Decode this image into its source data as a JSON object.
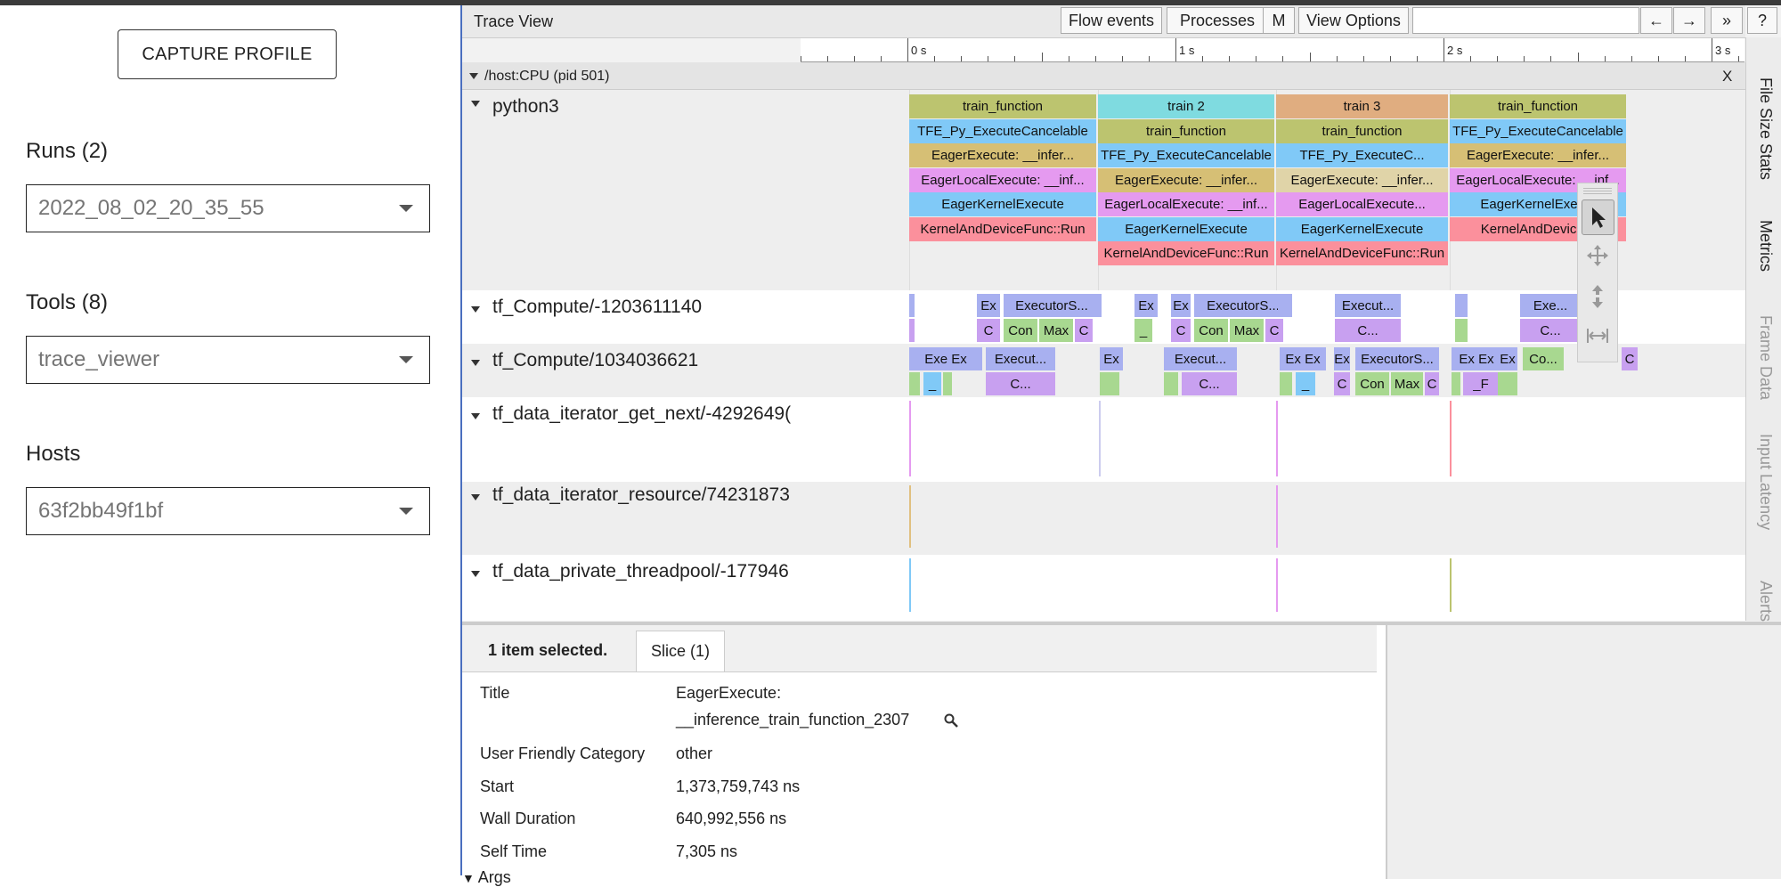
{
  "sidebar": {
    "capture_button": "CAPTURE PROFILE",
    "runs_label": "Runs (2)",
    "runs_value": "2022_08_02_20_35_55",
    "tools_label": "Tools (8)",
    "tools_value": "trace_viewer",
    "hosts_label": "Hosts",
    "hosts_value": "63f2bb49f1bf"
  },
  "trace_view": {
    "title": "Trace View",
    "toolbar": {
      "flow_events": "Flow events",
      "processes": "Processes",
      "m": "M",
      "view_options": "View Options",
      "prev": "←",
      "next": "→",
      "more": "»",
      "help": "?"
    },
    "ruler_labels": [
      "0 s",
      "1 s",
      "2 s",
      "3 s"
    ],
    "process": {
      "label": "/host:CPU (pid 501)",
      "close": "X"
    },
    "tracks": [
      "python3",
      "tf_Compute/-1203611140",
      "tf_Compute/1034036621",
      "tf_data_iterator_get_next/-4292649(",
      "tf_data_iterator_resource/74231873",
      "tf_data_private_threadpool/-177946"
    ],
    "python3_slices": [
      [
        {
          "label": "train_function",
          "color": "#bcc46f"
        },
        {
          "label": "TFE_Py_ExecuteCancelable",
          "color": "#80c9f7"
        },
        {
          "label": "EagerExecute: __infer...",
          "color": "#d6bf75"
        },
        {
          "label": "EagerLocalExecute: __inf...",
          "color": "#e59af0"
        },
        {
          "label": "EagerKernelExecute",
          "color": "#80c9f7"
        },
        {
          "label": "KernelAndDeviceFunc::Run",
          "color": "#fb909c"
        }
      ],
      [
        {
          "label": "train 2",
          "color": "#7fdbe0"
        },
        {
          "label": "train_function",
          "color": "#bcc46f"
        },
        {
          "label": "TFE_Py_ExecuteCancelable",
          "color": "#80c9f7"
        },
        {
          "label": "EagerExecute: __infer...",
          "color": "#d6bf75"
        },
        {
          "label": "EagerLocalExecute: __inf...",
          "color": "#e59af0"
        },
        {
          "label": "EagerKernelExecute",
          "color": "#80c9f7"
        },
        {
          "label": "KernelAndDeviceFunc::Run",
          "color": "#fb909c"
        }
      ],
      [
        {
          "label": "train 3",
          "color": "#e0ad80"
        },
        {
          "label": "train_function",
          "color": "#bcc46f"
        },
        {
          "label": "TFE_Py_ExecuteC...",
          "color": "#80c9f7"
        },
        {
          "label": "EagerExecute: __infer...",
          "color": "#e0d4a8"
        },
        {
          "label": "EagerLocalExecute...",
          "color": "#e59af0"
        },
        {
          "label": "EagerKernelExecute",
          "color": "#80c9f7"
        },
        {
          "label": "KernelAndDeviceFunc::Run",
          "color": "#fb909c"
        }
      ],
      [
        {
          "label": "train_function",
          "color": "#bcc46f"
        },
        {
          "label": "TFE_Py_ExecuteCancelable",
          "color": "#80c9f7"
        },
        {
          "label": "EagerExecute: __infer...",
          "color": "#d6bf75"
        },
        {
          "label": "EagerLocalExecute: __inf...",
          "color": "#e59af0"
        },
        {
          "label": "EagerKernelExec...",
          "color": "#80c9f7"
        },
        {
          "label": "KernelAndDevic...n",
          "color": "#fb909c"
        }
      ]
    ],
    "compute1_slices": [
      "Ex",
      "C",
      "ExecutorS...",
      "Con",
      "Max",
      "C",
      "Ex",
      "_",
      "Ex",
      "C",
      "ExecutorS...",
      "Con",
      "Max",
      "C",
      "Execut...",
      "C...",
      "Exe...",
      "C..."
    ],
    "compute2_slices": [
      "Exe Ex",
      "_",
      "Execut...",
      "C...",
      "Ex",
      "Execut...",
      "C...",
      "Ex Ex",
      "_",
      "Ex",
      "C",
      "ExecutorS...",
      "Con",
      "Max",
      "C",
      "Ex Ex",
      "_F",
      "Ex",
      "Co...",
      "C"
    ],
    "side_tabs": [
      "File Size Stats",
      "Metrics",
      "Frame Data",
      "Input Latency",
      "Alerts"
    ]
  },
  "details": {
    "selected_text": "1 item selected.",
    "tab": "Slice (1)",
    "rows": [
      {
        "key": "Title",
        "value": "EagerExecute:",
        "value2": "__inference_train_function_2307"
      },
      {
        "key": "User Friendly Category",
        "value": "other"
      },
      {
        "key": "Start",
        "value": "1,373,759,743 ns"
      },
      {
        "key": "Wall Duration",
        "value": "640,992,556 ns"
      },
      {
        "key": "Self Time",
        "value": "7,305 ns"
      },
      {
        "key": "Args",
        "value": ""
      }
    ]
  }
}
